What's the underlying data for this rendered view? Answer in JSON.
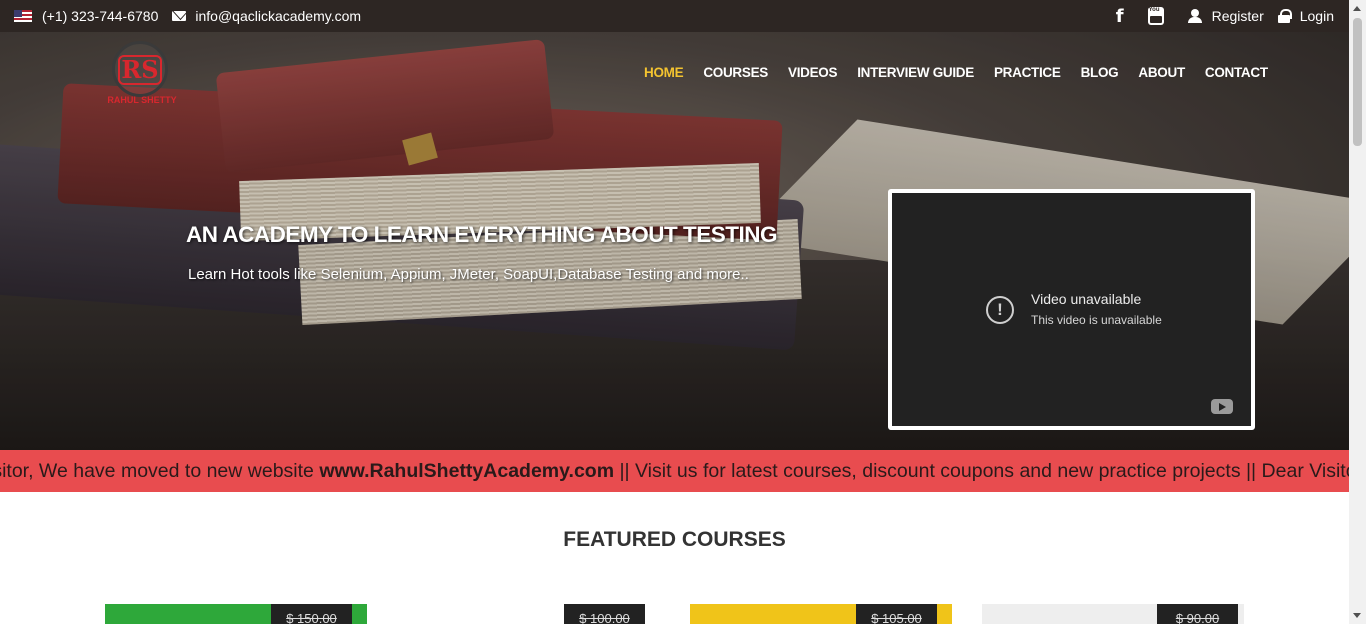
{
  "topbar": {
    "phone": "(+1) 323-744-6780",
    "email": "info@qaclickacademy.com",
    "facebook_glyph": "f",
    "register_label": "Register",
    "login_label": "Login"
  },
  "logo": {
    "letters": "RS",
    "name": "RAHUL SHETTY"
  },
  "nav": {
    "items": [
      {
        "label": "HOME",
        "active": true
      },
      {
        "label": "COURSES"
      },
      {
        "label": "VIDEOS"
      },
      {
        "label": "INTERVIEW GUIDE"
      },
      {
        "label": "PRACTICE"
      },
      {
        "label": "BLOG"
      },
      {
        "label": "ABOUT"
      },
      {
        "label": "CONTACT"
      }
    ]
  },
  "hero": {
    "title": "AN ACADEMY TO LEARN EVERYTHING ABOUT TESTING",
    "subtitle": "Learn Hot tools like Selenium, Appium, JMeter, SoapUI,Database Testing and more.."
  },
  "video": {
    "alert_glyph": "!",
    "title": "Video unavailable",
    "message": "This video is unavailable"
  },
  "marquee": {
    "prefix": "isitor, We have moved to new website ",
    "site": "www.RahulShettyAcademy.com",
    "suffix": " || Visit us for latest courses, discount coupons and new practice projects",
    "repeat": " || Dear Visitor, We hav"
  },
  "featured": {
    "title": "FEATURED COURSES",
    "courses": [
      {
        "price": "$ 150.00",
        "color": "#2ea83a"
      },
      {
        "price": "$ 100.00",
        "color": "#ffffff"
      },
      {
        "price": "$ 105.00",
        "color": "#f0c419"
      },
      {
        "price": "$ 90.00",
        "color": "#eeeeee"
      }
    ]
  },
  "colors": {
    "topbar_bg": "#2d2623",
    "nav_active": "#f4c430",
    "marquee_bg": "#e84c4f",
    "logo_red": "#d8272e"
  }
}
